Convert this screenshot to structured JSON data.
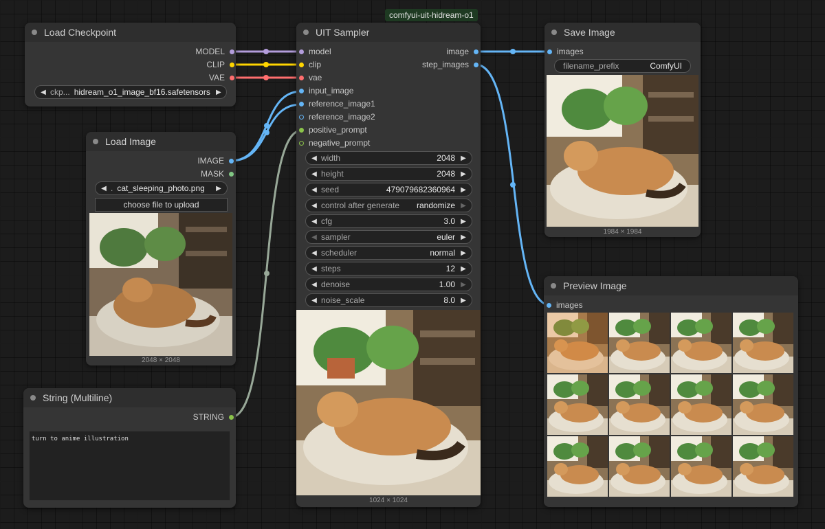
{
  "graph_name": "comfyui-uit-hidream-o1",
  "colors": {
    "model": "#b39ddb",
    "clip": "#ffd500",
    "vae": "#ff6e6e",
    "image": "#64b5f6",
    "mask": "#81c784",
    "string": "#8bc34a"
  },
  "load_checkpoint": {
    "title": "Load Checkpoint",
    "outputs": [
      "MODEL",
      "CLIP",
      "VAE"
    ],
    "ckpt_label": "ckp...",
    "ckpt_value": "hidream_o1_image_bf16.safetensors"
  },
  "load_image": {
    "title": "Load Image",
    "outputs": [
      "IMAGE",
      "MASK"
    ],
    "image_label": ".",
    "image_value": "cat_sleeping_photo.png",
    "upload_label": "choose file to upload",
    "size_label": "2048 × 2048"
  },
  "string_multiline": {
    "title": "String (Multiline)",
    "output": "STRING",
    "text": "turn to anime illustration"
  },
  "uit_sampler": {
    "title": "UIT Sampler",
    "inputs": [
      "model",
      "clip",
      "vae",
      "input_image",
      "reference_image1",
      "reference_image2",
      "positive_prompt",
      "negative_prompt"
    ],
    "outputs": [
      "image",
      "step_images"
    ],
    "widgets": [
      {
        "label": "width",
        "value": "2048"
      },
      {
        "label": "height",
        "value": "2048"
      },
      {
        "label": "seed",
        "value": "479079682360964"
      },
      {
        "label": "control after generate",
        "value": "randomize"
      },
      {
        "label": "cfg",
        "value": "3.0"
      },
      {
        "label": "sampler",
        "value": "euler"
      },
      {
        "label": "scheduler",
        "value": "normal"
      },
      {
        "label": "steps",
        "value": "12"
      },
      {
        "label": "denoise",
        "value": "1.00"
      },
      {
        "label": "noise_scale",
        "value": "8.0"
      }
    ],
    "size_label": "1024 × 1024"
  },
  "save_image": {
    "title": "Save Image",
    "input": "images",
    "prefix_label": "filename_prefix",
    "prefix_value": "ComfyUI",
    "size_label": "1984 × 1984"
  },
  "preview_image": {
    "title": "Preview Image",
    "input": "images"
  }
}
